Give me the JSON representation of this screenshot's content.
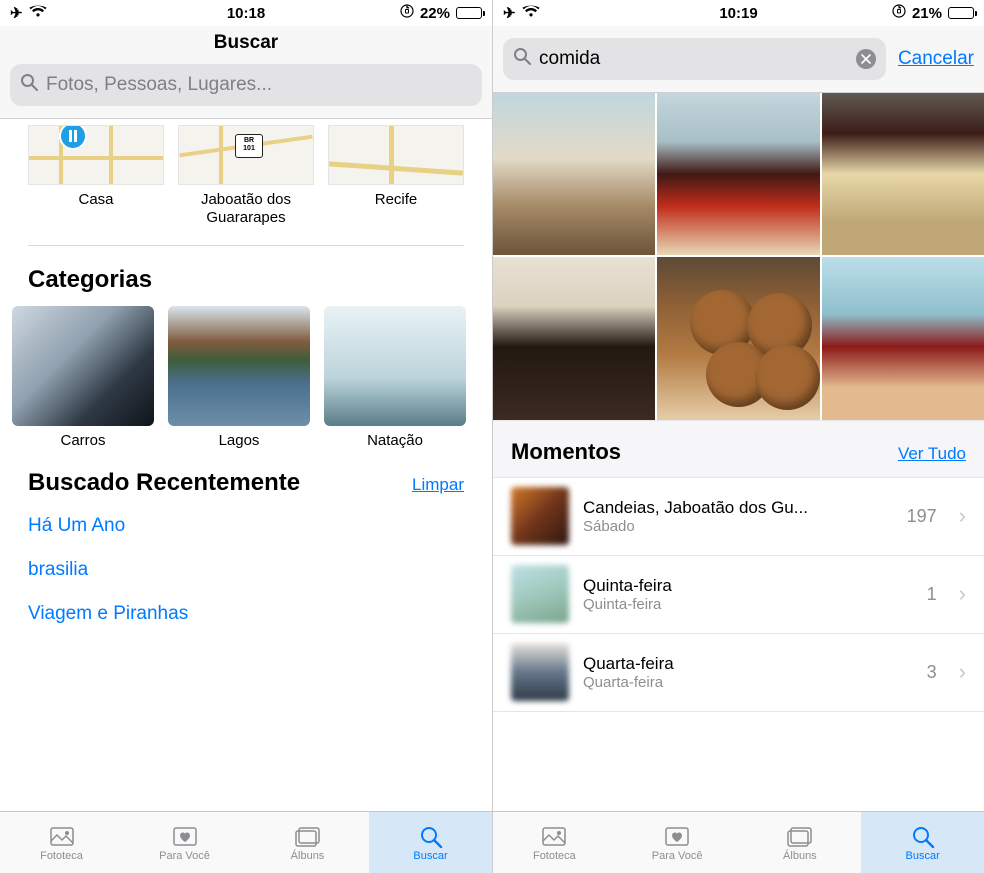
{
  "left": {
    "status": {
      "time": "10:18",
      "battery_text": "22%",
      "battery_pct": 22
    },
    "header_title": "Buscar",
    "search_placeholder": "Fotos, Pessoas, Lugares...",
    "places": [
      {
        "label": "Casa"
      },
      {
        "label": "Jaboatão dos Guararapes"
      },
      {
        "label": "Recife"
      }
    ],
    "br_badge": {
      "top": "BR",
      "bottom": "101"
    },
    "categories_title": "Categorias",
    "categories": [
      {
        "label": "Carros",
        "cls": "img-car"
      },
      {
        "label": "Lagos",
        "cls": "img-lake"
      },
      {
        "label": "Natação",
        "cls": "img-swim"
      }
    ],
    "recent_title": "Buscado Recentemente",
    "recent_action": "Limpar",
    "recent": [
      "Há Um Ano",
      "brasilia",
      "Viagem e Piranhas"
    ]
  },
  "right": {
    "status": {
      "time": "10:19",
      "battery_text": "21%",
      "battery_pct": 21
    },
    "search_value": "comida",
    "cancel": "Cancelar",
    "moments_title": "Momentos",
    "moments_action": "Ver Tudo",
    "moments": [
      {
        "title": "Candeias, Jaboatão dos Gu...",
        "sub": "Sábado",
        "count": "197",
        "cls": "mt1"
      },
      {
        "title": "Quinta-feira",
        "sub": "Quinta-feira",
        "count": "1",
        "cls": "mt2"
      },
      {
        "title": "Quarta-feira",
        "sub": "Quarta-feira",
        "count": "3",
        "cls": "mt3"
      }
    ]
  },
  "tabs": [
    {
      "label": "Fototeca",
      "icon": "library"
    },
    {
      "label": "Para Você",
      "icon": "heart"
    },
    {
      "label": "Álbuns",
      "icon": "albums"
    },
    {
      "label": "Buscar",
      "icon": "search"
    }
  ]
}
